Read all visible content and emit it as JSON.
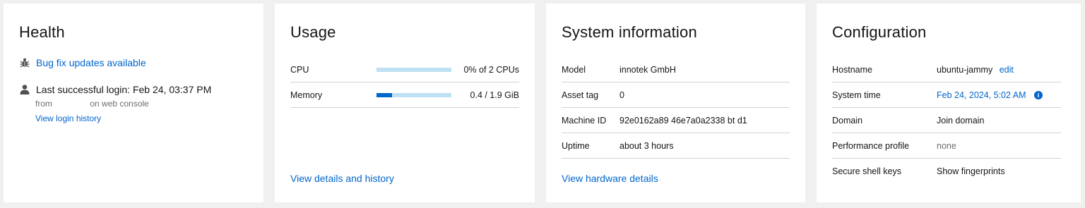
{
  "health": {
    "title": "Health",
    "bugfix_label": "Bug fix updates available",
    "login_label": "Last successful login: Feb 24, 03:37 PM",
    "login_from": "from                on web console",
    "login_history_label": "View login history"
  },
  "usage": {
    "title": "Usage",
    "rows": [
      {
        "label": "CPU",
        "value": "0% of 2 CPUs",
        "fraction": 0.0
      },
      {
        "label": "Memory",
        "value": "0.4 / 1.9 GiB",
        "fraction": 0.21
      }
    ],
    "details_label": "View details and history"
  },
  "sysinfo": {
    "title": "System information",
    "rows": [
      {
        "label": "Model",
        "value": "innotek GmbH"
      },
      {
        "label": "Asset tag",
        "value": "0"
      },
      {
        "label": "Machine ID",
        "value": "92e0162a89 46e7a0a2338 bt d1"
      },
      {
        "label": "Uptime",
        "value": "about 3 hours"
      }
    ],
    "hardware_label": "View hardware details"
  },
  "config": {
    "title": "Configuration",
    "hostname_label": "Hostname",
    "hostname_value": "ubuntu-jammy",
    "hostname_edit": "edit",
    "time_label": "System time",
    "time_value": "Feb 24, 2024, 5:02 AM",
    "domain_label": "Domain",
    "domain_value": "Join domain",
    "perf_label": "Performance profile",
    "perf_value": "none",
    "ssh_label": "Secure shell keys",
    "ssh_value": "Show fingerprints"
  },
  "icons": {
    "bugfix": "bug-icon",
    "login": "user-icon",
    "time_info": "info-icon"
  },
  "colors": {
    "link": "#0066cc",
    "bar_track": "#bee1f4",
    "bar_fill": "#0066cc"
  }
}
